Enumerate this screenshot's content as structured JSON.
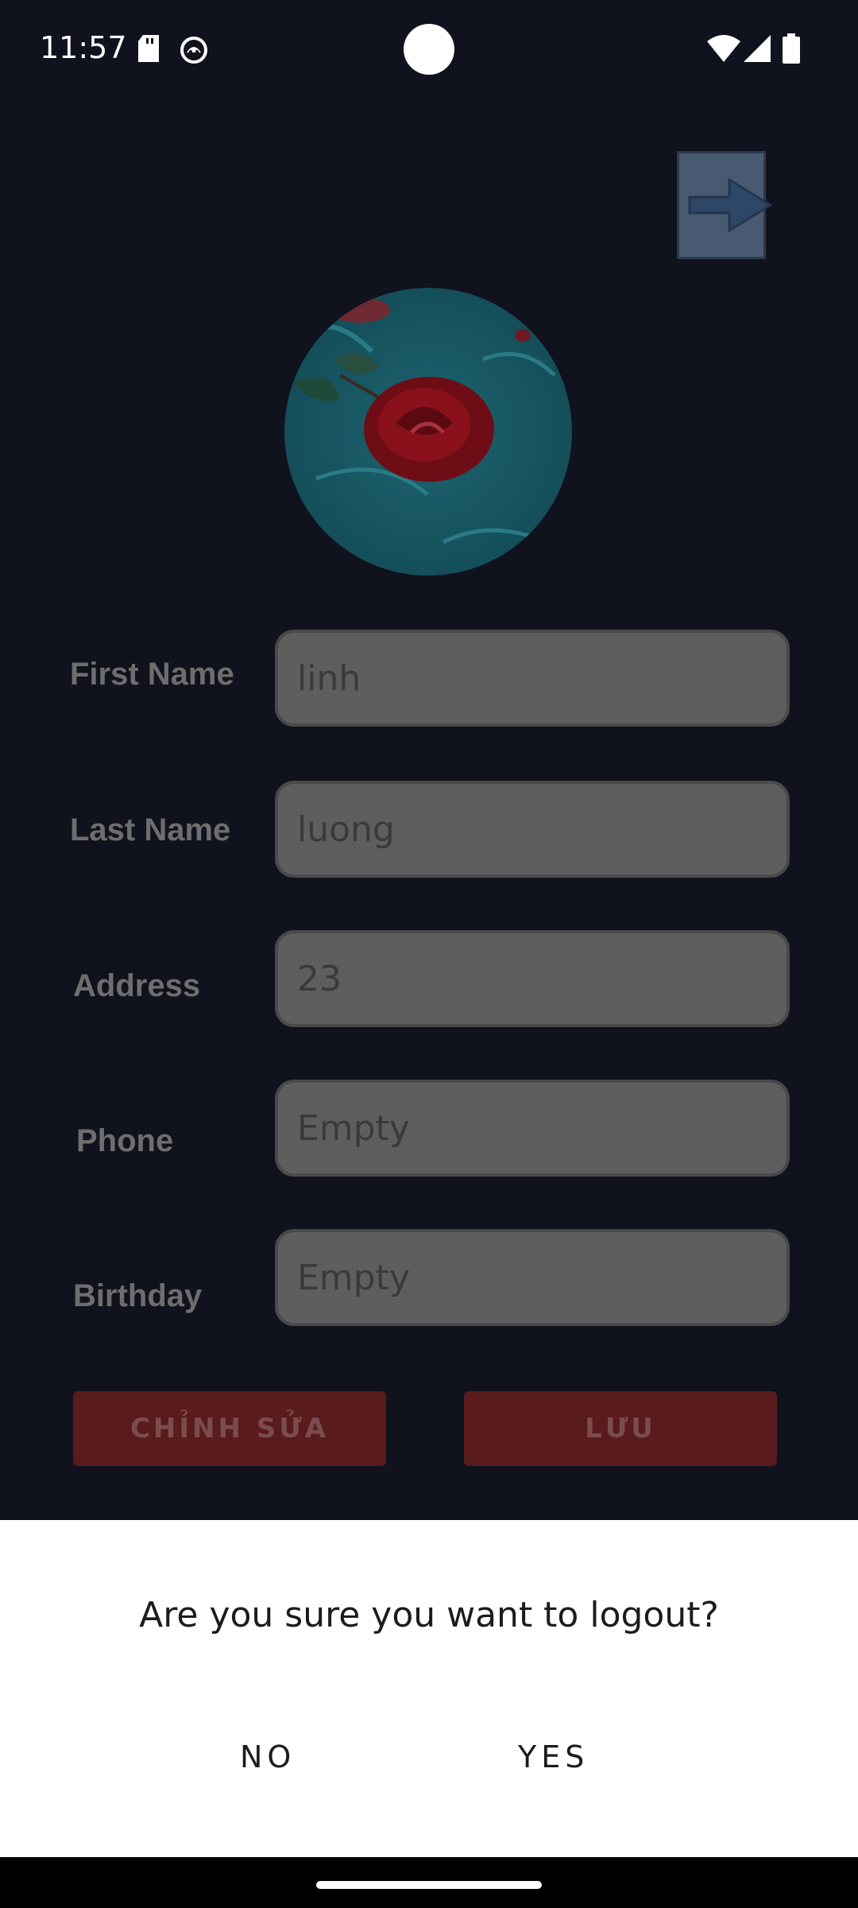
{
  "status_bar": {
    "time": "11:57",
    "icons": [
      "sd-card-icon",
      "cat-icon",
      "wifi-icon",
      "signal-icon",
      "battery-icon"
    ]
  },
  "header": {
    "logout_icon": "arrow-right-icon"
  },
  "profile": {
    "avatar": "rose-avatar"
  },
  "form": {
    "fields": [
      {
        "label": "First Name",
        "value": "linh"
      },
      {
        "label": "Last Name",
        "value": "luong"
      },
      {
        "label": "Address",
        "value": "23"
      },
      {
        "label": "Phone",
        "value": "Empty"
      },
      {
        "label": "Birthday",
        "value": "Empty"
      }
    ]
  },
  "actions": {
    "edit_label": "CHỈNH SỬA",
    "save_label": "LƯU"
  },
  "dialog": {
    "message": "Are you sure you want to logout?",
    "no_label": "NO",
    "yes_label": "YES"
  },
  "colors": {
    "background": "#10121d",
    "button": "#5a1b1d",
    "field": "#5e5e5e"
  }
}
